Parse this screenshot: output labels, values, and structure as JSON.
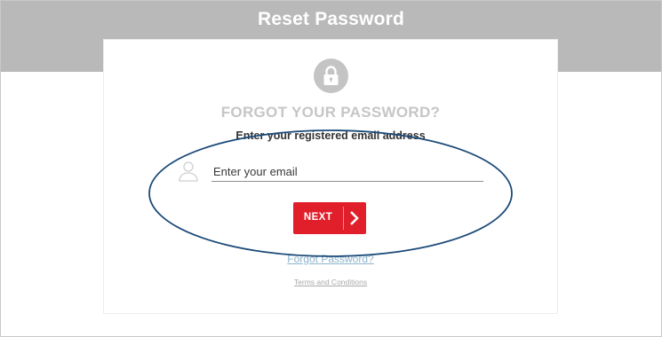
{
  "header": {
    "title": "Reset Password"
  },
  "card": {
    "icon": "lock-icon",
    "title": "FORGOT YOUR PASSWORD?",
    "subtitle": "Enter your registered email address",
    "email": {
      "icon": "user-icon",
      "placeholder": "Enter your email",
      "value": ""
    },
    "next_button": {
      "label": "NEXT",
      "icon": "chevron-right-icon"
    },
    "forgot_link": "Forgot Password?",
    "terms_link": "Terms and Conditions"
  },
  "annotation": {
    "shape": "ellipse",
    "color": "#1b4a78"
  },
  "colors": {
    "header_bg": "#b9b9b9",
    "accent_red": "#e11f2b",
    "link_blue": "#8db3cc",
    "title_gray": "#c6c6c6"
  }
}
